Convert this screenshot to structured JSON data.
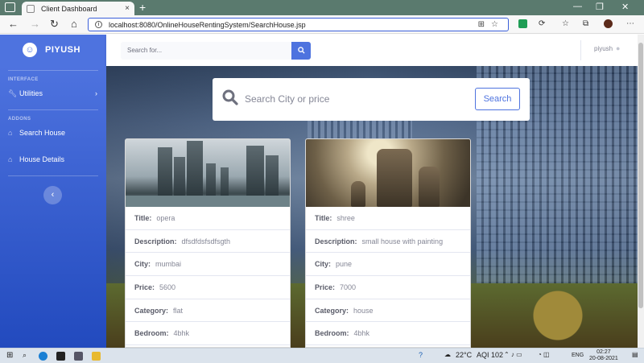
{
  "browser": {
    "tab_title": "Client Dashboard",
    "tab_close": "×",
    "new_tab": "+",
    "url": "localhost:8080/OnlineHouseRentingSystem/SearchHouse.jsp"
  },
  "sidebar": {
    "brand_icon": "☺",
    "brand": "PIYUSH",
    "heading_interface": "INTERFACE",
    "heading_addons": "ADDONS",
    "items": [
      {
        "label": "Utilities",
        "icon": "wrench-icon"
      },
      {
        "label": "Search House",
        "icon": "home-icon"
      },
      {
        "label": "House Details",
        "icon": "home-icon"
      }
    ],
    "toggle": "‹"
  },
  "topbar": {
    "search_placeholder": "Search for...",
    "user": "piyush"
  },
  "search": {
    "placeholder": "Search City or price",
    "button": "Search"
  },
  "labels": {
    "title": "Title:",
    "description": "Description:",
    "city": "City:",
    "price": "Price:",
    "category": "Category:",
    "bedroom": "Bedroom:"
  },
  "houses": [
    {
      "title": "opera",
      "description": "dfsdfdsfsdfsgth",
      "city": "mumbai",
      "price": "5600",
      "category": "flat",
      "bedroom": "4bhk",
      "image": "city-skyline-image"
    },
    {
      "title": "shree",
      "description": "small house with painting",
      "city": "pune",
      "price": "7000",
      "category": "house",
      "bedroom": "4bhk",
      "image": "soldiers-image"
    }
  ],
  "taskbar": {
    "temperature": "22°C",
    "aqi": "AQI 102",
    "language": "ENG",
    "time": "02:27",
    "date": "20-08-2021"
  },
  "colors": {
    "primary": "#4e73df",
    "sidebar_dark": "#224abe"
  }
}
